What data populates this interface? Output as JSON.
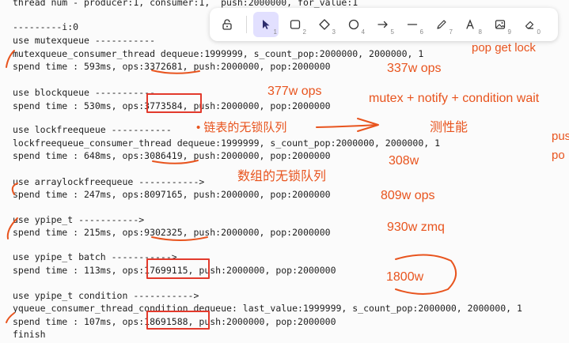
{
  "terminal": {
    "lines": [
      "thread num - producer:1, consumer:1,  push:2000000, for_value:1",
      "---------i:0",
      "use mutexqueue -----------",
      "mutexqueue_consumer_thread dequeue:1999999, s_count_pop:2000000, 2000000, 1",
      "spend time : 593ms, ops:3372681, push:2000000, pop:2000000",
      "use blockqueue -----------",
      "spend time : 530ms, ops:3773584, push:2000000, pop:2000000",
      "use lockfreequeue -----------",
      "lockfreequeue_consumer_thread dequeue:1999999, s_count_pop:2000000, 2000000, 1",
      "spend time : 648ms, ops:3086419, push:2000000, pop:2000000",
      "use arraylockfreequeue ----------->",
      "spend time : 247ms, ops:8097165, push:2000000, pop:2000000",
      "use ypipe_t ----------->",
      "spend time : 215ms, ops:9302325, push:2000000, pop:2000000",
      "use ypipe_t batch ----------->",
      "spend time : 113ms, ops:17699115, push:2000000, pop:2000000",
      "use ypipe_t condition ----------->",
      "yqueue_consumer_thread_condition dequeue: last_value:1999999, s_count_pop:2000000, 2000000, 1",
      "spend time : 107ms, ops:18691588, push:2000000, pop:2000000",
      "finish"
    ]
  },
  "annotations": {
    "top_right": "ck",
    "pop_get_lock": "pop get lock",
    "ops_337": "337w ops",
    "ops_377": "377w ops",
    "mutex_notify": "mutex + notify + condition wait",
    "linked_list": "• 链表的无锁队列",
    "test_perf": "测性能",
    "push_edge": "push",
    "po_edge": "po",
    "ops_308": "308w",
    "array_lockfree": "数组的无锁队列",
    "ops_809": "809w ops",
    "ops_930": "930w  zmq",
    "ops_1800": "1800w"
  },
  "toolbar": {
    "tools": [
      {
        "name": "lock-tool",
        "num": ""
      },
      {
        "name": "select-tool",
        "num": "1"
      },
      {
        "name": "rectangle-tool",
        "num": "2"
      },
      {
        "name": "diamond-tool",
        "num": "3"
      },
      {
        "name": "ellipse-tool",
        "num": "4"
      },
      {
        "name": "arrow-tool",
        "num": "5"
      },
      {
        "name": "line-tool",
        "num": "6"
      },
      {
        "name": "draw-tool",
        "num": "7"
      },
      {
        "name": "text-tool",
        "num": "8"
      },
      {
        "name": "image-tool",
        "num": "9"
      },
      {
        "name": "eraser-tool",
        "num": "0"
      }
    ]
  },
  "colors": {
    "annotation": "#e8541e",
    "box": "#e23a2c",
    "toolbar_active": "#e2e0ff",
    "terminal_text": "#1e1e1e"
  }
}
